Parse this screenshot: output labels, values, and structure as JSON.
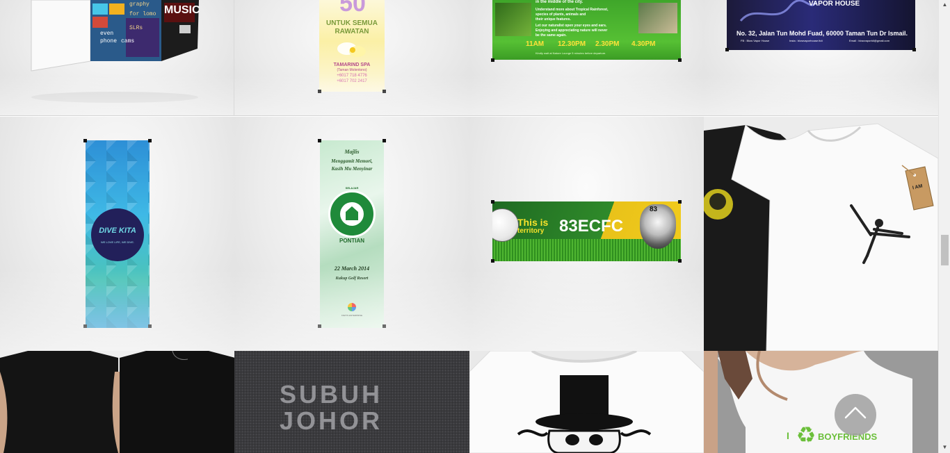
{
  "gallery": {
    "row1": {
      "music_box": {
        "label_music": "MUSIC",
        "text_lines": [
          "graphy",
          "for lomo",
          "SLRs",
          "even",
          "phone",
          "cams"
        ]
      },
      "spa_banner": {
        "number": "50",
        "line1": "UNTUK SEMUA",
        "line2": "RAWATAN",
        "brand": "TAMARIND SPA",
        "sub": "(Taman Molentono)",
        "phone1": "+6017 718 4776",
        "phone2": "+6017 702 2417"
      },
      "rainforest_banner": {
        "heading": "in the middle of the city.",
        "body1": "Understand more about Tropical Rainforest,",
        "body2": "species of plants, animals and",
        "body3": "their unique features.",
        "body4": "Let our naturalist open your eyes and ears.",
        "body5": "Enjoying and appreciating nature will never",
        "body6": "be the same again.",
        "times": [
          "11AM",
          "12.30PM",
          "2.30PM",
          "4.30PM"
        ],
        "footnote": "Kindly wait at Nature Lounge 5 minutes before departure."
      },
      "vapor_banner": {
        "brand": "VAPOR HOUSE",
        "address": "No. 32, Jalan Tun Mohd Fuad, 60000 Taman Tun Dr Ismail.",
        "fb": "FB : Blow Vapor House",
        "insta": "Insta : blowvaporhouse.ttdi",
        "email": "Email : blowvaportdi@gmail.com"
      }
    },
    "row2": {
      "divekita_banner": {
        "logo": "DIVE KITA",
        "tagline": "WE LOVE LIFE, WE DIVE."
      },
      "majlis_banner": {
        "title1": "Majlis",
        "title2": "Menggamit Memori,",
        "title3": "Kasih Mu Menyinar",
        "badge_top": "SELAJAR",
        "badge_bottom": "PONTIAN",
        "date": "22 March 2014",
        "venue": "Kukup Golf Resort",
        "sponsor": "KIWITS ENTERPRISE"
      },
      "football_banner": {
        "prefix": "This is",
        "name": "83ECFC",
        "sub": "territory",
        "badge": "83"
      },
      "tshirt_white": {
        "tag_text": "I AM"
      }
    },
    "row3": {
      "black_tees": {
        "print": "SUBUH JOHOR"
      },
      "skull_tee": {},
      "recycle_tee": {
        "letter": "I",
        "word": "BOYFRIENDS"
      }
    }
  },
  "ui": {
    "scroll_top_label": "Back to top",
    "scroll_up_glyph": "▲",
    "scroll_down_glyph": "▼"
  }
}
